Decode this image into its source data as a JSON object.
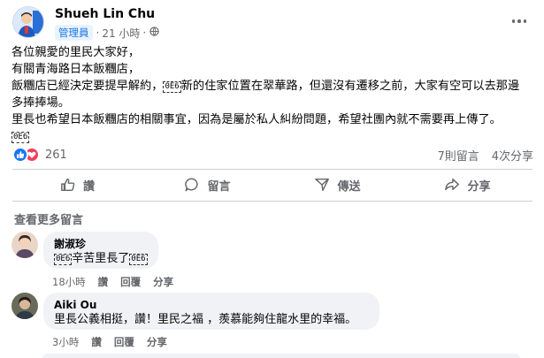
{
  "post": {
    "author": "Shueh Lin Chu",
    "role": "管理員",
    "time": "21 小時",
    "separator": "·",
    "lines": [
      "各位親愛的里民大家好，",
      "有關青海路日本飯糰店，",
      [
        "飯糰店已經決定要提早解約，",
        "新的住家位置在翠華路，但還沒有遷移之前，大家有空可以去那邊"
      ],
      "多捧捧場。",
      "里長也希望日本飯糰店的相關事宜，因為是屬於私人糾紛問題，希望社團內就不需要再上傳了。"
    ],
    "emoji_placeholder": "0E6"
  },
  "reactions": {
    "count": "261",
    "comments": "7則留言",
    "shares": "4次分享",
    "colors": {
      "like": "#1877f2",
      "love": "#f33e58"
    }
  },
  "actions": {
    "like": "讚",
    "comment": "留言",
    "send": "傳送",
    "share": "分享"
  },
  "see_more_comments": "查看更多留言",
  "comments": [
    {
      "name": "謝淑珍",
      "text_before": "",
      "text_middle": "辛苦里長了",
      "time": "18小時",
      "like": "讚",
      "reply": "回覆",
      "share": "分享"
    },
    {
      "name": "Aiki Ou",
      "text": "里長公義相挺，讚！里民之福 ，羨慕能夠住龍水里的幸福。",
      "time": "3小時",
      "like": "讚",
      "reply": "回覆",
      "share": "分享"
    }
  ]
}
